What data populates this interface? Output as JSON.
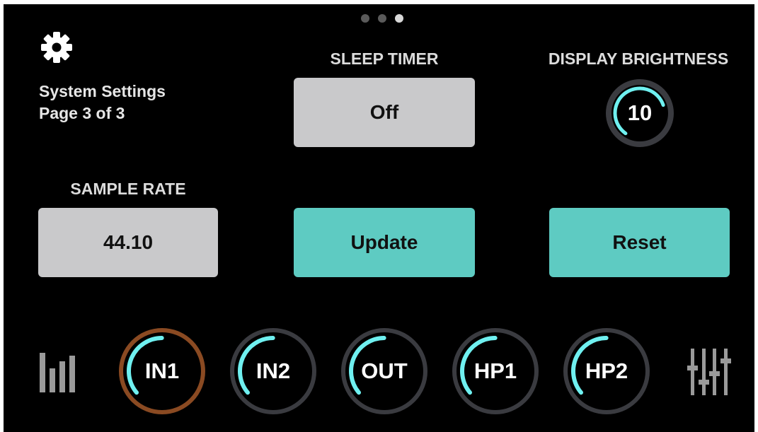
{
  "page_indicator": {
    "pages": 3,
    "current": 3
  },
  "system": {
    "title": "System Settings",
    "page_text": "Page 3 of 3",
    "icon": "gear-icon"
  },
  "sleep_timer": {
    "label": "SLEEP TIMER",
    "value": "Off"
  },
  "display_brightness": {
    "label": "DISPLAY BRIGHTNESS",
    "value": "10",
    "level": 0.35
  },
  "sample_rate": {
    "label": "SAMPLE RATE",
    "value": "44.10"
  },
  "actions": {
    "update": "Update",
    "reset": "Reset"
  },
  "channels": [
    {
      "label": "IN1",
      "selected": true,
      "level": 0.36
    },
    {
      "label": "IN2",
      "selected": false,
      "level": 0.36
    },
    {
      "label": "OUT",
      "selected": false,
      "level": 0.36
    },
    {
      "label": "HP1",
      "selected": false,
      "level": 0.36
    },
    {
      "label": "HP2",
      "selected": false,
      "level": 0.36
    }
  ],
  "bottom_icons": {
    "left": "bar-meter-icon",
    "right": "mixer-sliders-icon"
  },
  "colors": {
    "background": "#000000",
    "accent": "#5ecbc2",
    "arc": "#6ff0f0",
    "ring": "#3a3b40",
    "selected_ring": "#8a4a22",
    "button_gray": "#c9c9cb"
  }
}
